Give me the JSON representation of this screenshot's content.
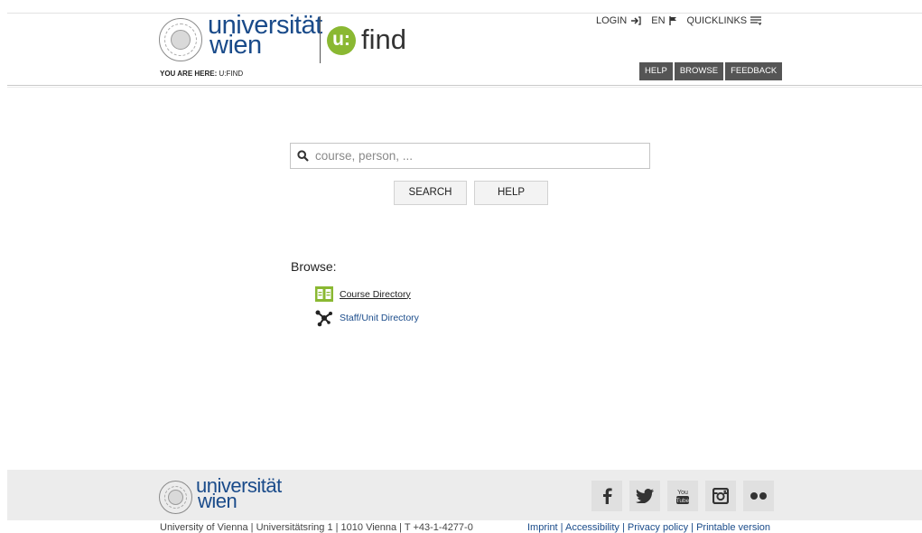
{
  "header": {
    "logo_line1": "universität",
    "logo_line2": "wien",
    "app_badge": "u:",
    "app_name": "find",
    "breadcrumb_label": "YOU ARE HERE:",
    "breadcrumb_current": "U:FIND"
  },
  "topnav": {
    "login": "LOGIN",
    "language": "EN",
    "quicklinks": "QUICKLINKS"
  },
  "tabs": [
    "HELP",
    "BROWSE",
    "FEEDBACK"
  ],
  "search": {
    "placeholder": "course, person, ...",
    "search_button": "SEARCH",
    "help_button": "HELP"
  },
  "browse": {
    "title": "Browse:",
    "items": [
      {
        "label": "Course Directory",
        "icon": "book-icon"
      },
      {
        "label": "Staff/Unit Directory",
        "icon": "network-icon"
      }
    ]
  },
  "footer": {
    "logo_line1": "universität",
    "logo_line2": "wien",
    "address": "University of Vienna | Universitätsring 1 | 1010 Vienna | T +43-1-4277-0",
    "links": "Imprint | Accessibility | Privacy policy | Printable version",
    "social": [
      "facebook-icon",
      "twitter-icon",
      "youtube-icon",
      "instagram-icon",
      "flickr-icon"
    ]
  },
  "colors": {
    "brand_blue": "#1a4b8a",
    "ufind_green": "#8ab832",
    "tab_bg": "#555555",
    "footer_bg": "#ececec"
  }
}
